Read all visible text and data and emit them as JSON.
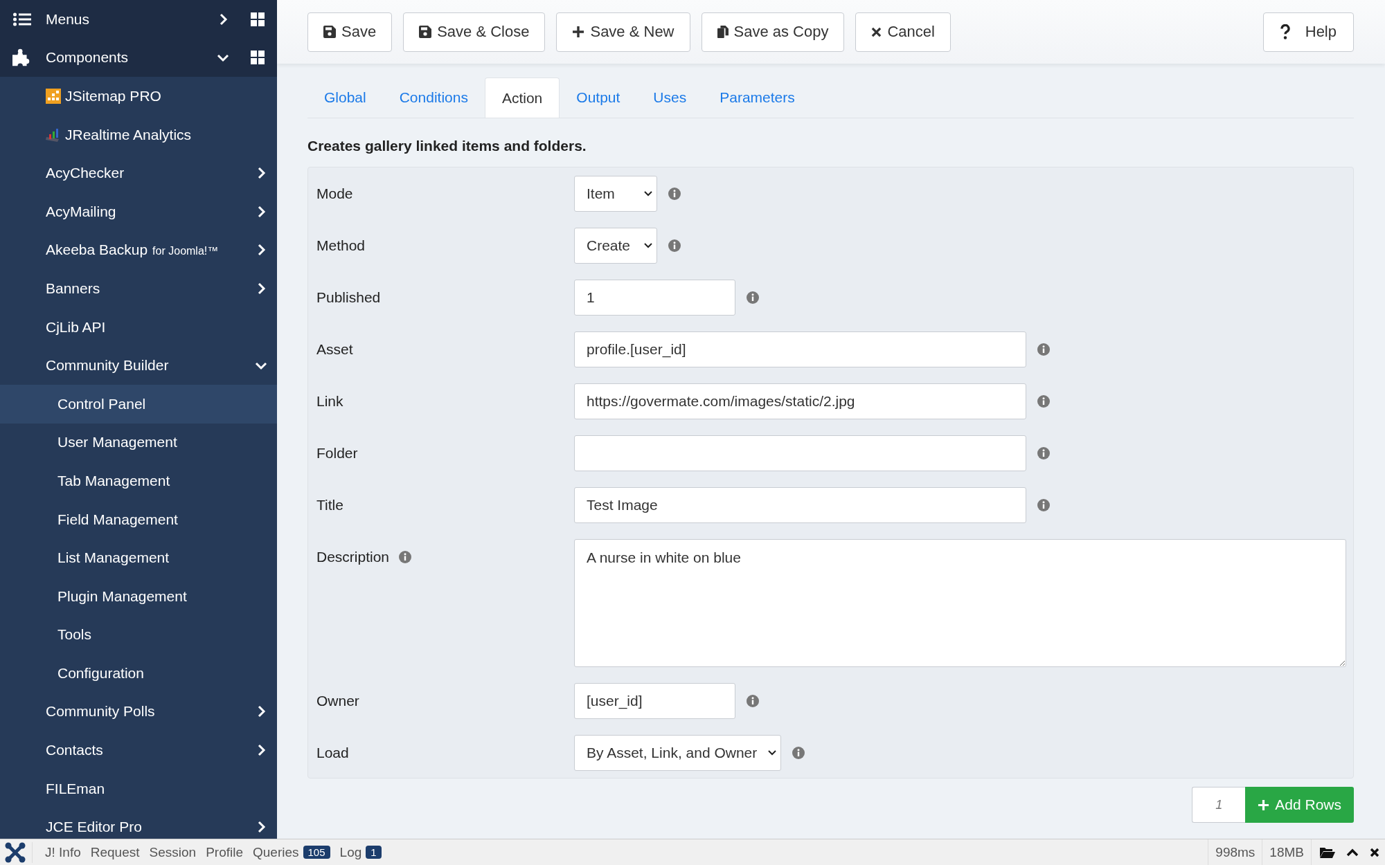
{
  "sidebar": {
    "items": [
      {
        "label": "Menus",
        "kind": "section",
        "expandable": true,
        "expanded": false,
        "selected": false
      },
      {
        "label": "Components",
        "kind": "section",
        "expandable": true,
        "expanded": true,
        "selected": false,
        "children": [
          {
            "label": "JSitemap PRO",
            "kind": "sitemap",
            "expandable": false,
            "expanded": false,
            "selected": false
          },
          {
            "label": "JRealtime Analytics",
            "kind": "chart",
            "expandable": false,
            "expanded": false,
            "selected": false
          },
          {
            "label": "AcyChecker",
            "kind": "plain",
            "expandable": true,
            "expanded": false,
            "selected": false
          },
          {
            "label": "AcyMailing",
            "kind": "plain",
            "expandable": true,
            "expanded": false,
            "selected": false
          },
          {
            "label": "Akeeba Backup",
            "suffix": "for Joomla!™",
            "kind": "plain",
            "expandable": true,
            "expanded": false,
            "selected": false
          },
          {
            "label": "Banners",
            "kind": "plain",
            "expandable": true,
            "expanded": false,
            "selected": false
          },
          {
            "label": "CjLib API",
            "kind": "plain",
            "expandable": false,
            "expanded": false,
            "selected": false
          },
          {
            "label": "Community Builder",
            "kind": "plain",
            "expandable": true,
            "expanded": true,
            "selected": false,
            "children": [
              {
                "label": "Control Panel",
                "selected": true
              },
              {
                "label": "User Management",
                "selected": false
              },
              {
                "label": "Tab Management",
                "selected": false
              },
              {
                "label": "Field Management",
                "selected": false
              },
              {
                "label": "List Management",
                "selected": false
              },
              {
                "label": "Plugin Management",
                "selected": false
              },
              {
                "label": "Tools",
                "selected": false
              },
              {
                "label": "Configuration",
                "selected": false
              }
            ]
          },
          {
            "label": "Community Polls",
            "kind": "plain",
            "expandable": true,
            "expanded": false,
            "selected": false
          },
          {
            "label": "Contacts",
            "kind": "plain",
            "expandable": true,
            "expanded": false,
            "selected": false
          },
          {
            "label": "FILEman",
            "kind": "plain",
            "expandable": false,
            "expanded": false,
            "selected": false
          },
          {
            "label": "JCE Editor Pro",
            "kind": "plain",
            "expandable": true,
            "expanded": false,
            "selected": false
          }
        ]
      }
    ]
  },
  "toolbar": {
    "buttons": [
      {
        "label": "Save",
        "kind": "save"
      },
      {
        "label": "Save & Close",
        "kind": "save"
      },
      {
        "label": "Save & New",
        "kind": "plus"
      },
      {
        "label": "Save as Copy",
        "kind": "copy"
      },
      {
        "label": "Cancel",
        "kind": "cancel"
      }
    ],
    "help": {
      "label": "Help",
      "kind": "help"
    }
  },
  "tabs": [
    {
      "label": "Global",
      "selected": false
    },
    {
      "label": "Conditions",
      "selected": false
    },
    {
      "label": "Action",
      "selected": true
    },
    {
      "label": "Output",
      "selected": false
    },
    {
      "label": "Uses",
      "selected": false
    },
    {
      "label": "Parameters",
      "selected": false
    }
  ],
  "description": "Creates gallery linked items and folders.",
  "form": {
    "fields": [
      {
        "label": "Mode",
        "kind": "select",
        "value": "Item",
        "info_on_label": false
      },
      {
        "label": "Method",
        "kind": "select",
        "value": "Create",
        "info_on_label": false
      },
      {
        "label": "Published",
        "kind": "short_text",
        "value": "1",
        "info_on_label": false
      },
      {
        "label": "Asset",
        "kind": "long_text",
        "value": "profile.[user_id]",
        "info_on_label": false
      },
      {
        "label": "Link",
        "kind": "long_text",
        "value": "https://govermate.com/images/static/2.jpg",
        "info_on_label": false
      },
      {
        "label": "Folder",
        "kind": "long_text",
        "info_on_label": false
      },
      {
        "label": "Title",
        "kind": "long_text",
        "value": "Test Image",
        "info_on_label": false
      },
      {
        "label": "Description",
        "kind": "textarea",
        "value": "A nurse in white on blue",
        "info_on_label": true
      },
      {
        "label": "Owner",
        "kind": "short_text",
        "value": "[user_id]",
        "info_on_label": false
      },
      {
        "label": "Load",
        "kind": "select",
        "value": "By Asset, Link, and Owner",
        "info_on_label": false
      }
    ]
  },
  "add_rows": {
    "count_placeholder": "1",
    "button": "Add Rows"
  },
  "debug_bar": {
    "items": [
      {
        "label": "J! Info"
      },
      {
        "label": "Request"
      },
      {
        "label": "Session"
      },
      {
        "label": "Profile"
      },
      {
        "label": "Queries",
        "badge": "105"
      },
      {
        "label": "Log",
        "badge": "1"
      }
    ],
    "time": "998ms",
    "memory": "18MB"
  }
}
